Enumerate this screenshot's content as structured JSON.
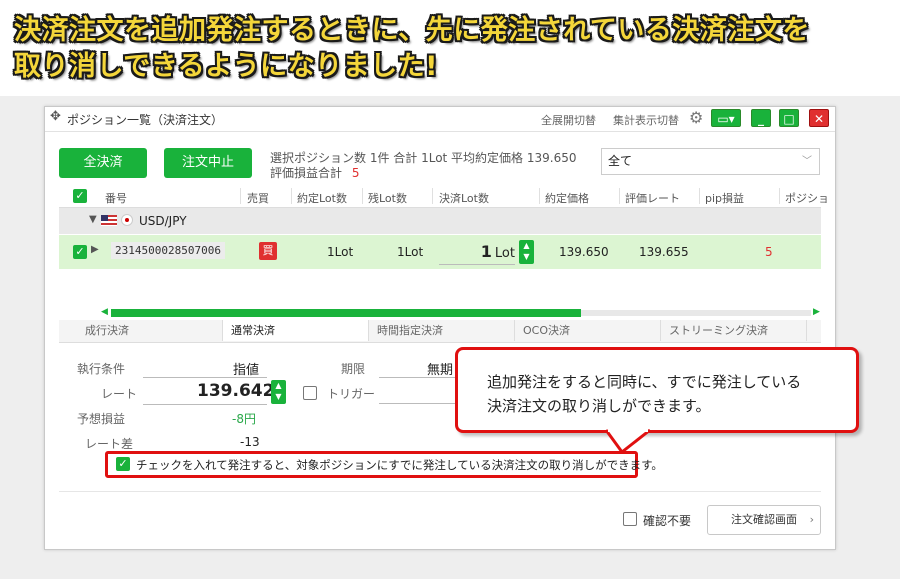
{
  "headline": {
    "line1": "決済注文を追加発注するときに、先に発注されている決済注文を",
    "line2": "取り消しできるようになりました!"
  },
  "window": {
    "title": "ポジション一覧（決済注文）",
    "expand_toggle": "全展開切替",
    "summary_toggle": "集計表示切替"
  },
  "actions": {
    "settle_all": "全決済",
    "cancel_order": "注文中止"
  },
  "summary": {
    "line1": "選択ポジション数 1件  合計 1Lot 平均約定価格 139.650",
    "pl_label": "評価損益合計",
    "pl_value": "5"
  },
  "filter": {
    "selected": "全て"
  },
  "table": {
    "headers": [
      "番号",
      "売買",
      "約定Lot数",
      "残Lot数",
      "決済Lot数",
      "約定価格",
      "評価レート",
      "pip損益",
      "ポジショ"
    ],
    "group": {
      "pair": "USD/JPY"
    },
    "row": {
      "id": "2314500028507006",
      "side": "買",
      "filled_lot": "1Lot",
      "remaining_lot": "1Lot",
      "settle_lot_num": "1",
      "settle_lot_unit": "Lot",
      "price": "139.650",
      "rate": "139.655",
      "pip": "5"
    }
  },
  "tabs": [
    "成行決済",
    "通常決済",
    "時間指定決済",
    "OCO決済",
    "ストリーミング決済"
  ],
  "form": {
    "cond_label": "執行条件",
    "cond_value": "指値",
    "expiry_label": "期限",
    "expiry_value": "無期",
    "rate_label": "レート",
    "rate_value": "139.642",
    "trigger_label": "トリガー",
    "exp_pl_label": "予想損益",
    "exp_pl_value": "-8円",
    "diff_label": "レート差",
    "diff_value": "-13",
    "cancel_check_text": "チェックを入れて発注すると、対象ポジションにすでに発注している決済注文の取り消しができます。"
  },
  "footer": {
    "no_confirm": "確認不要",
    "confirm_screen": "注文確認画面"
  },
  "callout": {
    "line1": "追加発注をすると同時に、すでに発注している",
    "line2": "決済注文の取り消しができます。"
  },
  "colors": {
    "accent": "#19b23b",
    "alert": "#e01010",
    "headline": "#f4d63a"
  }
}
